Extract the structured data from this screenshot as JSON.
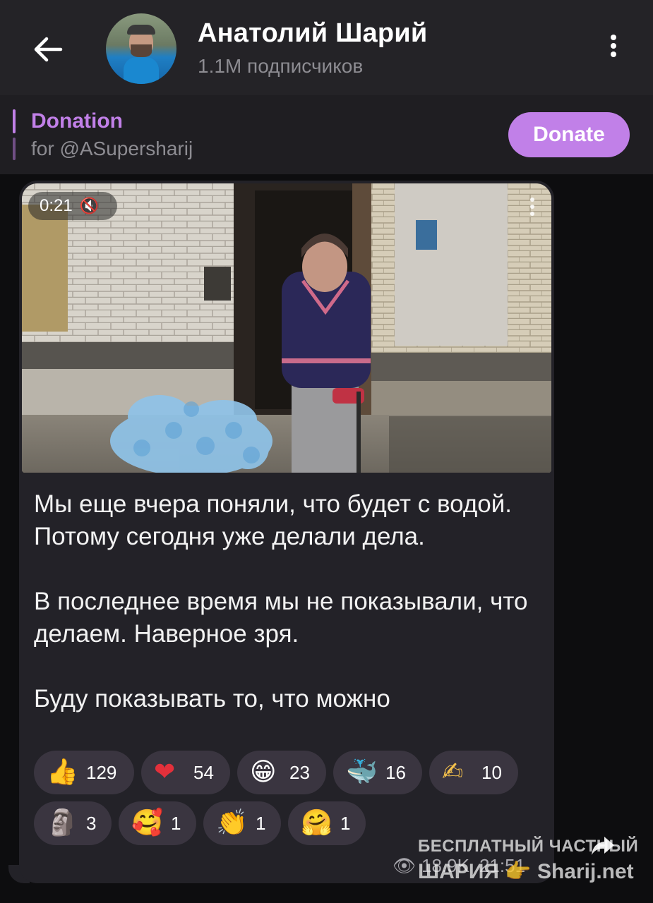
{
  "header": {
    "channel_name": "Анатолий Шарий",
    "subscribers": "1.1M подписчиков"
  },
  "pinned": {
    "title": "Donation",
    "subtitle": "for @ASupersharij",
    "button_label": "Donate"
  },
  "video": {
    "duration": "0:21",
    "mute_icon": "speaker-muted-icon"
  },
  "message": {
    "text": "Мы еще вчера поняли, что будет с водой. Потому сегодня уже делали дела.\n\nВ последнее время мы не показывали, что делаем. Наверное зря.\n\nБуду показывать то, что можно"
  },
  "reactions": [
    {
      "emoji": "👍",
      "count": "129"
    },
    {
      "emoji": "❤",
      "count": "54"
    },
    {
      "emoji": "😁",
      "count": "23"
    },
    {
      "emoji": "🐳",
      "count": "16"
    },
    {
      "emoji": "✍",
      "count": "10"
    },
    {
      "emoji": "🗿",
      "count": "3"
    },
    {
      "emoji": "🥰",
      "count": "1"
    },
    {
      "emoji": "👏",
      "count": "1"
    },
    {
      "emoji": "🤗",
      "count": "1"
    }
  ],
  "footer": {
    "views": "18.9K",
    "time": "21:51"
  },
  "watermark": {
    "line1": "БЕСПЛАТНЫЙ ЧАСТНЫЙ",
    "line2": "ШАРИЯ 👉 Sharij.net"
  },
  "colors": {
    "accent": "#c180e8",
    "header_bg": "#242327",
    "bubble_bg": "#232228",
    "reaction_bg": "#3a3540"
  }
}
